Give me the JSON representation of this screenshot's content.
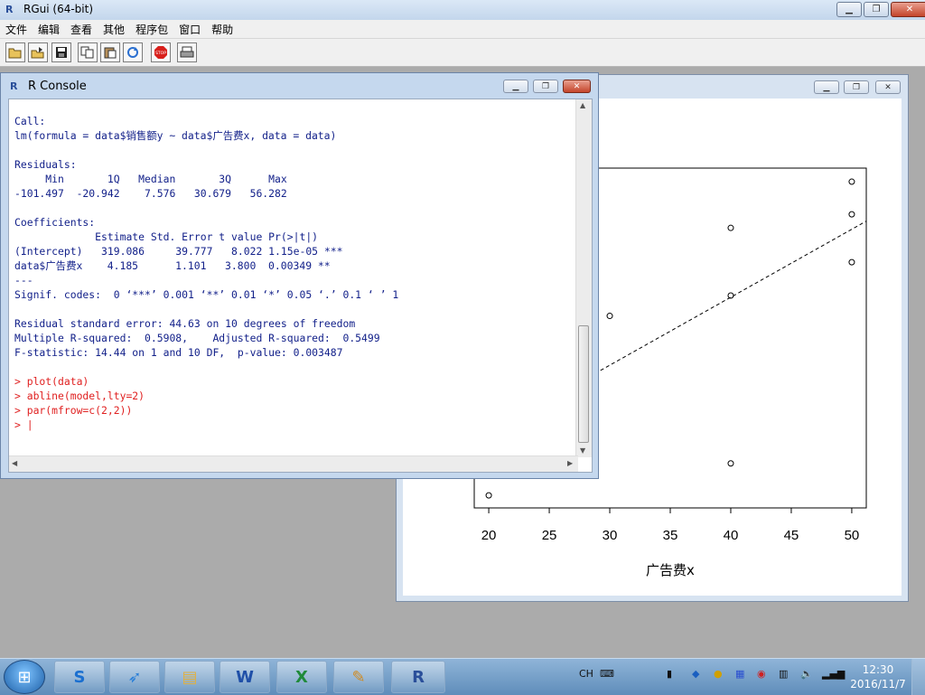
{
  "app": {
    "title": "RGui (64-bit)",
    "logo": "R"
  },
  "menu": [
    "文件",
    "编辑",
    "查看",
    "其他",
    "程序包",
    "窗口",
    "帮助"
  ],
  "toolbar_icons": [
    "open-script-icon",
    "load-workspace-icon",
    "save-icon",
    "copy-icon",
    "paste-icon",
    "copy-paste-icon",
    "refresh-icon",
    "stop-icon",
    "print-icon"
  ],
  "console": {
    "title": "R Console",
    "lines": [
      {
        "text": "",
        "type": "out"
      },
      {
        "text": "Call:",
        "type": "out"
      },
      {
        "text": "lm(formula = data$销售额y ~ data$广告费x, data = data)",
        "type": "out"
      },
      {
        "text": "",
        "type": "out"
      },
      {
        "text": "Residuals:",
        "type": "out"
      },
      {
        "text": "     Min       1Q   Median       3Q      Max ",
        "type": "out"
      },
      {
        "text": "-101.497  -20.942    7.576   30.679   56.282 ",
        "type": "out"
      },
      {
        "text": "",
        "type": "out"
      },
      {
        "text": "Coefficients:",
        "type": "out"
      },
      {
        "text": "             Estimate Std. Error t value Pr(>|t|)    ",
        "type": "out"
      },
      {
        "text": "(Intercept)   319.086     39.777   8.022 1.15e-05 ***",
        "type": "out"
      },
      {
        "text": "data$广告费x    4.185      1.101   3.800  0.00349 ** ",
        "type": "out"
      },
      {
        "text": "---",
        "type": "out"
      },
      {
        "text": "Signif. codes:  0 ‘***’ 0.001 ‘**’ 0.01 ‘*’ 0.05 ‘.’ 0.1 ‘ ’ 1",
        "type": "out"
      },
      {
        "text": "",
        "type": "out"
      },
      {
        "text": "Residual standard error: 44.63 on 10 degrees of freedom",
        "type": "out"
      },
      {
        "text": "Multiple R-squared:  0.5908,\tAdjusted R-squared:  0.5499 ",
        "type": "out"
      },
      {
        "text": "F-statistic: 14.44 on 1 and 10 DF,  p-value: 0.003487",
        "type": "out"
      },
      {
        "text": "",
        "type": "out"
      },
      {
        "text": "> plot(data)",
        "type": "cmd"
      },
      {
        "text": "> abline(model,lty=2)",
        "type": "cmd"
      },
      {
        "text": "> par(mfrow=c(2,2))",
        "type": "cmd"
      },
      {
        "text": "> ",
        "type": "cmd"
      }
    ]
  },
  "chart_data": {
    "type": "scatter",
    "xlabel": "广告费x",
    "x_ticks": [
      20,
      25,
      30,
      35,
      40,
      45,
      50
    ],
    "xlim": [
      18.8,
      51.2
    ],
    "ylim": [
      0,
      100
    ],
    "points": [
      {
        "x": 50,
        "y": 96
      },
      {
        "x": 50,
        "y": 86.4
      },
      {
        "x": 40,
        "y": 82.4
      },
      {
        "x": 50,
        "y": 72.3
      },
      {
        "x": 40,
        "y": 62.5
      },
      {
        "x": 30,
        "y": 56.5
      },
      {
        "x": 40,
        "y": 13.1
      },
      {
        "x": 20,
        "y": 3.7
      }
    ],
    "regression_line": {
      "x1": 26.5,
      "y1": 35,
      "x2": 51.2,
      "y2": 84.4,
      "style": "dashed"
    }
  },
  "taskbar": {
    "apps": [
      "sogou-icon",
      "feiyu-icon",
      "explorer-icon",
      "word-icon",
      "excel-icon",
      "paint-icon",
      "r-icon"
    ],
    "tray_text": "CH",
    "time": "12:30",
    "date": "2016/11/7"
  }
}
